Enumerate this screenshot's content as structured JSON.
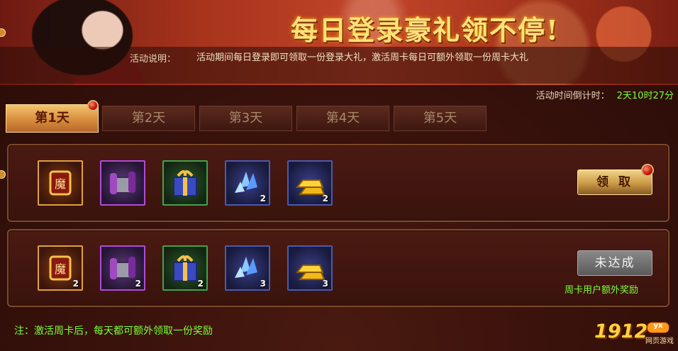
{
  "banner": {
    "headline": "每日登录豪礼领不停!",
    "desc_label": "活动说明：",
    "desc_text": "活动期间每日登录即可领取一份登录大礼，激活周卡每日可额外领取一份周卡大礼"
  },
  "countdown": {
    "label": "活动时间倒计时：",
    "value": "2天10时27分"
  },
  "tabs": [
    {
      "label": "第1天",
      "active": true
    },
    {
      "label": "第2天",
      "active": false
    },
    {
      "label": "第3天",
      "active": false
    },
    {
      "label": "第4天",
      "active": false
    },
    {
      "label": "第5天",
      "active": false
    }
  ],
  "daily_reward": {
    "items": [
      {
        "icon": "medal-icon",
        "count": ""
      },
      {
        "icon": "scroll-icon",
        "count": ""
      },
      {
        "icon": "gift-box-icon",
        "count": ""
      },
      {
        "icon": "crystal-icon",
        "count": "2"
      },
      {
        "icon": "gold-ingot-icon",
        "count": "2"
      }
    ],
    "button_label": "领 取"
  },
  "weekcard_reward": {
    "items": [
      {
        "icon": "medal-icon",
        "count": "2"
      },
      {
        "icon": "scroll-icon",
        "count": "2"
      },
      {
        "icon": "gift-box-icon",
        "count": "2"
      },
      {
        "icon": "crystal-icon",
        "count": "3"
      },
      {
        "icon": "gold-ingot-icon",
        "count": "3"
      }
    ],
    "button_label": "未达成",
    "note": "周卡用户额外奖励"
  },
  "footer_note": "注：激活周卡后，每天都可额外领取一份奖励",
  "logo": {
    "number": "1912",
    "badge": "yx",
    "sub": "网页游戏"
  },
  "colors": {
    "accent_green": "#7cff3a",
    "headline_gold": "#ffe27a",
    "tab_active": "#d78d3c"
  }
}
